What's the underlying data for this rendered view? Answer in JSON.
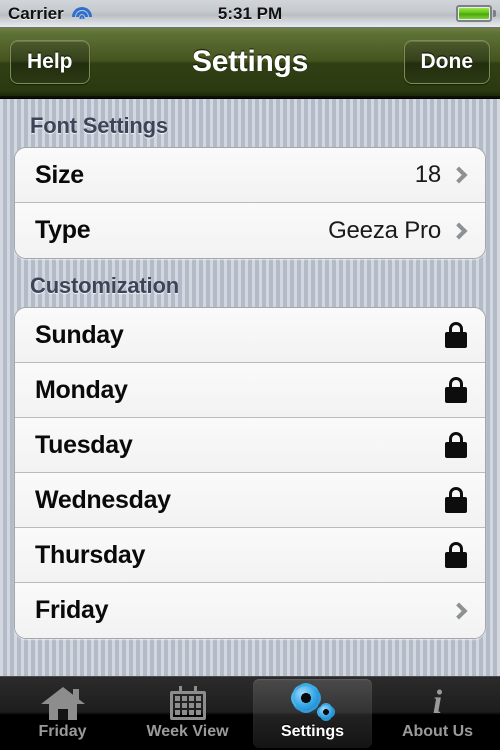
{
  "status_bar": {
    "carrier": "Carrier",
    "wifi_icon": "wifi-icon",
    "time": "5:31 PM",
    "battery_icon": "battery-icon"
  },
  "nav_bar": {
    "left_button": "Help",
    "title": "Settings",
    "right_button": "Done"
  },
  "sections": [
    {
      "header": "Font Settings",
      "rows": [
        {
          "label": "Size",
          "value": "18",
          "accessory": "chevron"
        },
        {
          "label": "Type",
          "value": "Geeza Pro",
          "accessory": "chevron"
        }
      ]
    },
    {
      "header": "Customization",
      "rows": [
        {
          "label": "Sunday",
          "value": "",
          "accessory": "lock"
        },
        {
          "label": "Monday",
          "value": "",
          "accessory": "lock"
        },
        {
          "label": "Tuesday",
          "value": "",
          "accessory": "lock"
        },
        {
          "label": "Wednesday",
          "value": "",
          "accessory": "lock"
        },
        {
          "label": "Thursday",
          "value": "",
          "accessory": "lock"
        },
        {
          "label": "Friday",
          "value": "",
          "accessory": "chevron"
        }
      ]
    }
  ],
  "tab_bar": {
    "tabs": [
      {
        "label": "Friday",
        "icon": "home-icon",
        "active": false
      },
      {
        "label": "Week View",
        "icon": "calendar-icon",
        "active": false
      },
      {
        "label": "Settings",
        "icon": "gears-icon",
        "active": true
      },
      {
        "label": "About Us",
        "icon": "info-icon",
        "active": false
      }
    ]
  },
  "colors": {
    "nav_bar_green": "#46551f",
    "background": "#bcc3cf",
    "accent_blue": "#35a8e8",
    "section_header": "#3c4557"
  }
}
